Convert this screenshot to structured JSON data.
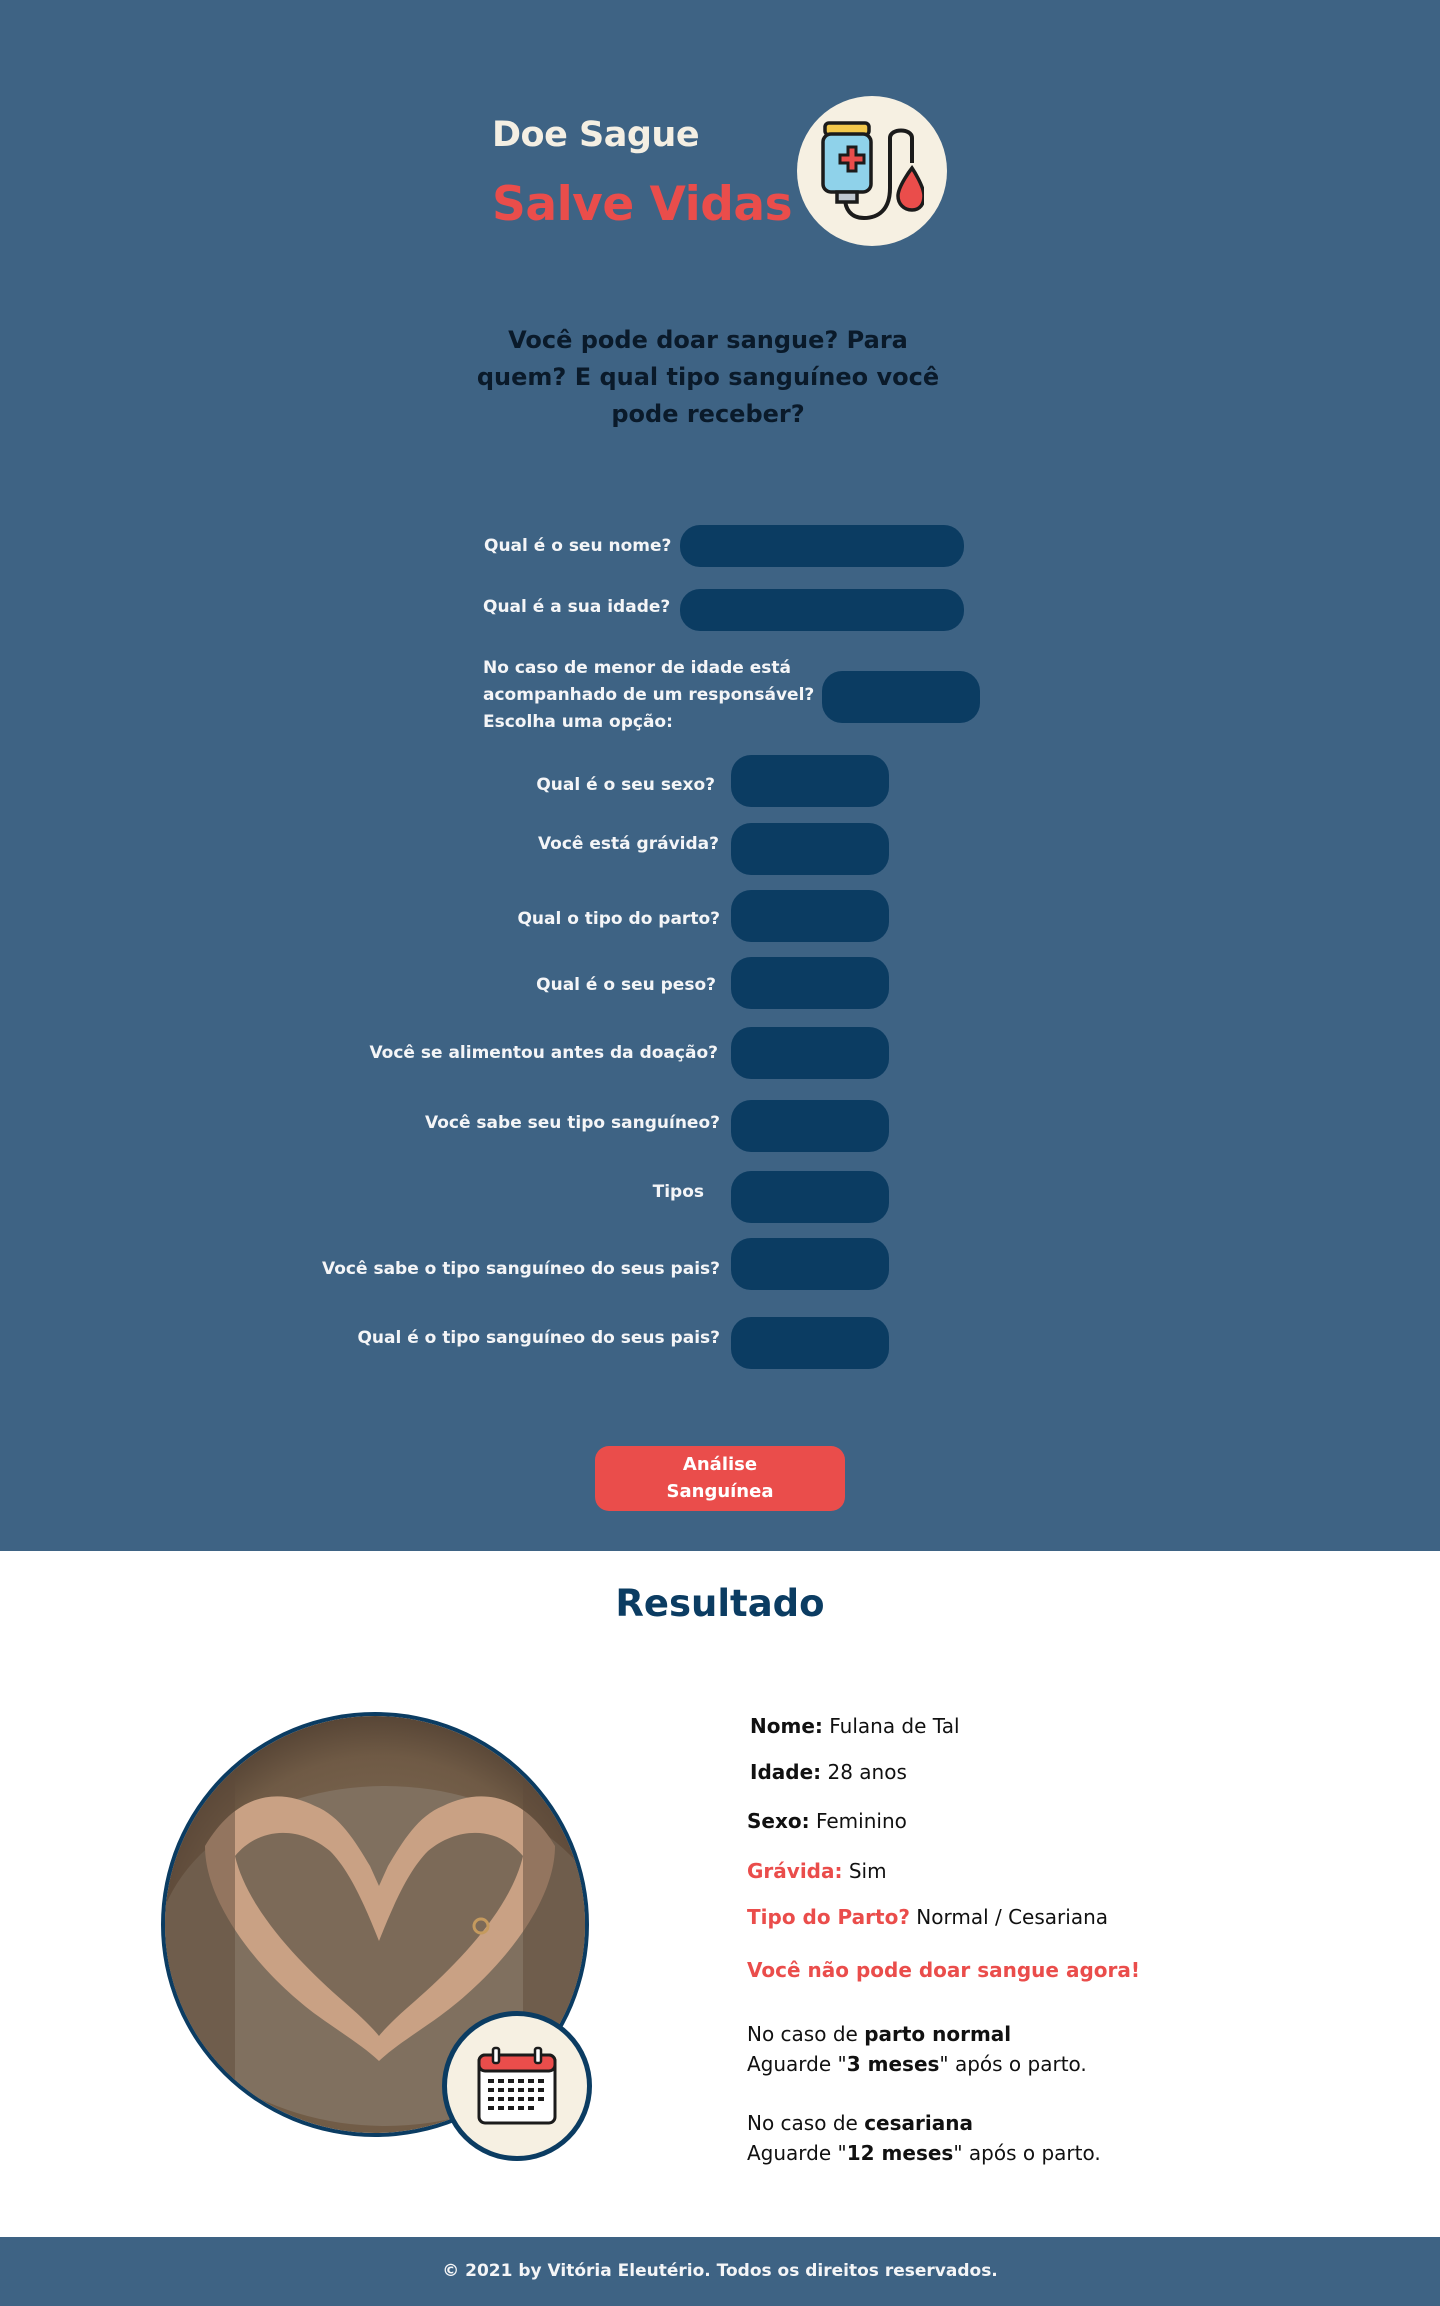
{
  "brand": {
    "line1": "Doe Sague",
    "line2": "Salve Vidas",
    "logo_icon": "blood-bag-icon"
  },
  "intro": "Você pode doar sangue? Para quem? E qual tipo sanguíneo você pode receber?",
  "form": {
    "name_label": "Qual é o seu nome?",
    "age_label": "Qual é a sua idade?",
    "guardian_label_1": "No caso de menor de idade está",
    "guardian_label_2": "acompanhado de um responsável?",
    "guardian_label_3": "Escolha uma opção:",
    "sex_label": "Qual é o seu sexo?",
    "pregnant_label": "Você está grávida?",
    "birth_type_label": "Qual o tipo do parto?",
    "weight_label": "Qual é o seu peso?",
    "fed_label": "Você se alimentou antes da doação?",
    "knows_type_label": "Você sabe seu tipo sanguíneo?",
    "types_label": "Tipos",
    "knows_parents_label": "Você sabe o tipo sanguíneo do seus pais?",
    "parents_type_label": "Qual é o tipo sanguíneo do seus pais?",
    "submit_line1": "Análise",
    "submit_line2": "Sanguínea"
  },
  "result": {
    "title": "Resultado",
    "name_key": "Nome:",
    "name_value": " Fulana de Tal",
    "age_key": "Idade:",
    "age_value": " 28 anos",
    "sex_key": "Sexo:",
    "sex_value": " Feminino",
    "pregnant_key": "Grávida:",
    "pregnant_value": " Sim",
    "birth_key": "Tipo do Parto?",
    "birth_value": " Normal / Cesariana",
    "warning": "Você não pode doar sangue agora!",
    "normal_pre": "No caso de ",
    "normal_bold": "parto normal",
    "normal_wait_pre": "Aguarde \"",
    "normal_wait_bold": "3 meses",
    "normal_wait_post": "\" após o parto.",
    "cesarean_pre": "No caso de ",
    "cesarean_bold": "cesariana",
    "cesarean_wait_pre": "Aguarde \"",
    "cesarean_wait_bold": "12 meses",
    "cesarean_wait_post": "\" após o parto.",
    "photo_icon": "pregnant-belly-photo",
    "calendar_icon": "calendar-icon"
  },
  "footer": "© 2021 by Vitória Eleutério. Todos os direitos reservados.",
  "colors": {
    "background": "#3e6384",
    "field": "#0b3c62",
    "accent": "#ea4d4b",
    "cream": "#f6f0e2"
  }
}
